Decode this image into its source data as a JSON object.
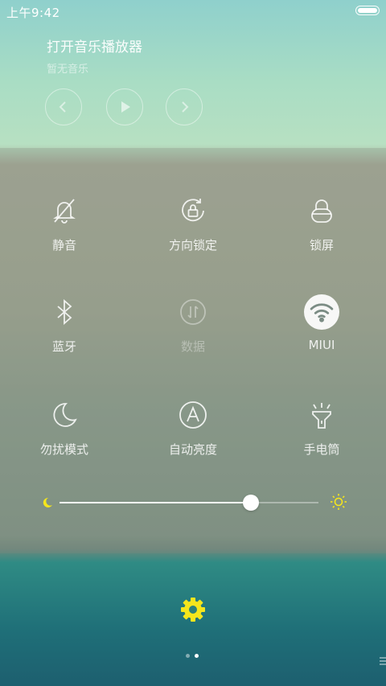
{
  "status_bar": {
    "time": "上午9:42"
  },
  "music": {
    "title": "打开音乐播放器",
    "subtitle": "暂无音乐",
    "controls": [
      "previous-icon",
      "play-icon",
      "next-icon"
    ]
  },
  "toggles": [
    {
      "label": "静音",
      "icon": "bell-off-icon",
      "active": false
    },
    {
      "label": "方向锁定",
      "icon": "rotation-lock-icon",
      "active": false
    },
    {
      "label": "锁屏",
      "icon": "lock-icon",
      "active": false
    },
    {
      "label": "蓝牙",
      "icon": "bluetooth-icon",
      "active": false
    },
    {
      "label": "数据",
      "icon": "mobile-data-icon",
      "active": false,
      "disabled": true
    },
    {
      "label": "MIUI",
      "icon": "wifi-icon",
      "active": true
    },
    {
      "label": "勿扰模式",
      "icon": "moon-icon",
      "active": false
    },
    {
      "label": "自动亮度",
      "icon": "auto-brightness-icon",
      "active": false
    },
    {
      "label": "手电筒",
      "icon": "flashlight-icon",
      "active": false
    }
  ],
  "brightness": {
    "level": 0.74,
    "accent": "#f5e61c"
  },
  "bottom": {
    "settings_icon": "gear-icon",
    "page_count": 2,
    "current_page": 2
  },
  "colors": {
    "accent": "#f5e61c"
  }
}
